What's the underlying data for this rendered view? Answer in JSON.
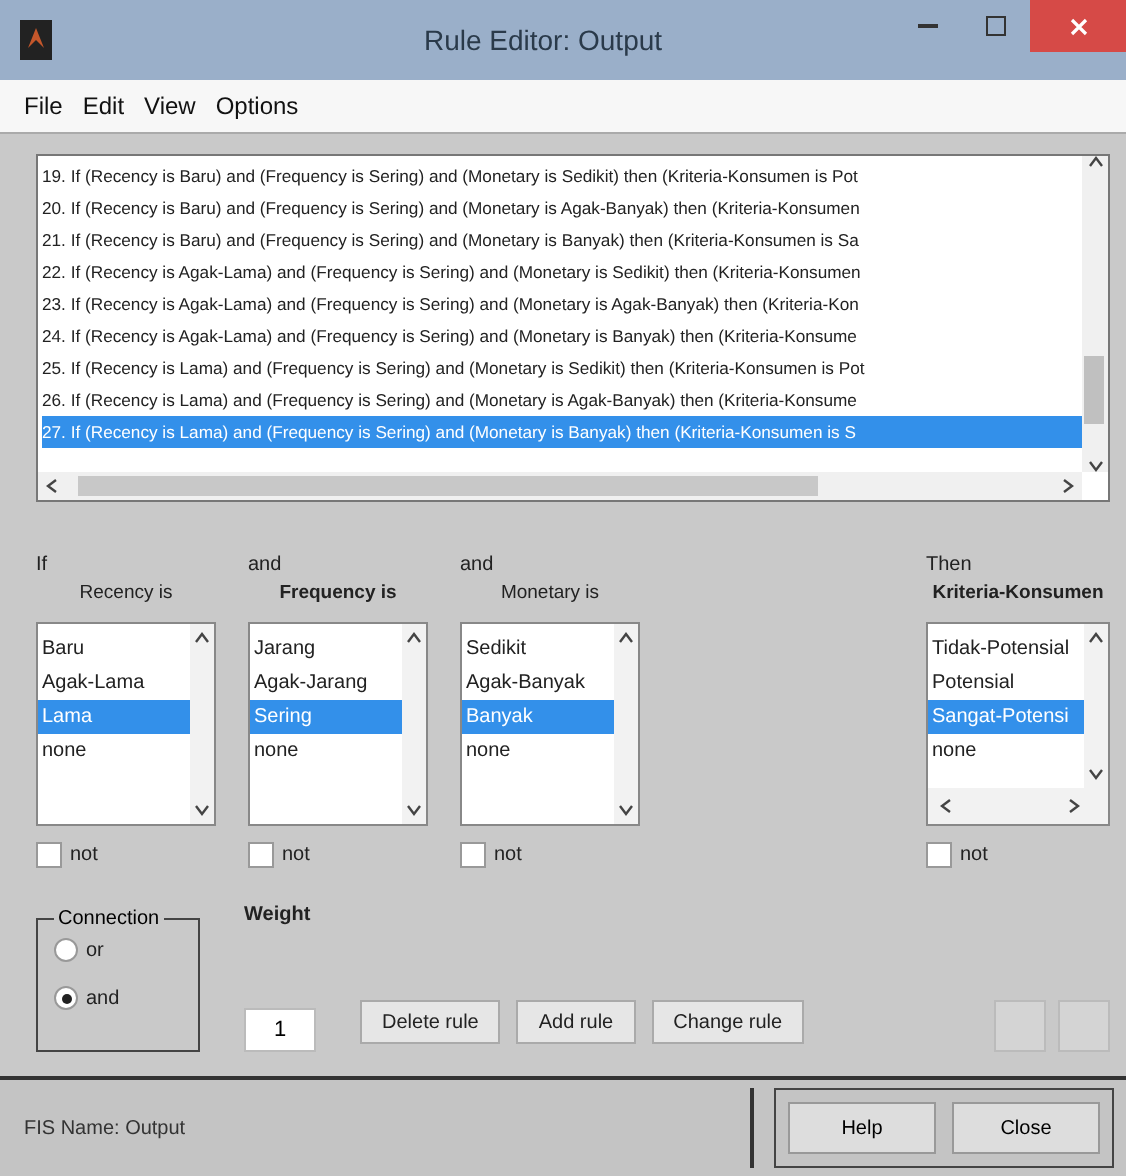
{
  "window": {
    "title": "Rule Editor: Output"
  },
  "menu": [
    "File",
    "Edit",
    "View",
    "Options"
  ],
  "rules": [
    {
      "text": "19. If (Recency is Baru) and (Frequency is Sering) and (Monetary is Sedikit) then (Kriteria-Konsumen is Pot",
      "selected": false
    },
    {
      "text": "20. If (Recency is Baru) and (Frequency is Sering) and (Monetary is Agak-Banyak) then (Kriteria-Konsumen",
      "selected": false
    },
    {
      "text": "21. If (Recency is Baru) and (Frequency is Sering) and (Monetary is Banyak) then (Kriteria-Konsumen is Sa",
      "selected": false
    },
    {
      "text": "22. If (Recency is Agak-Lama) and (Frequency is Sering) and (Monetary is Sedikit) then (Kriteria-Konsumen",
      "selected": false
    },
    {
      "text": "23. If (Recency is Agak-Lama) and (Frequency is Sering) and (Monetary is Agak-Banyak) then (Kriteria-Kon",
      "selected": false
    },
    {
      "text": "24. If (Recency is Agak-Lama) and (Frequency is Sering) and (Monetary is Banyak) then (Kriteria-Konsume",
      "selected": false
    },
    {
      "text": "25. If (Recency is Lama) and (Frequency is Sering) and (Monetary is Sedikit) then (Kriteria-Konsumen is Pot",
      "selected": false
    },
    {
      "text": "26. If (Recency is Lama) and (Frequency is Sering) and (Monetary is Agak-Banyak) then (Kriteria-Konsume",
      "selected": false
    },
    {
      "text": "27. If (Recency is Lama) and (Frequency is Sering) and (Monetary is Banyak) then (Kriteria-Konsumen is S",
      "selected": true
    }
  ],
  "variables": [
    {
      "kind": "input",
      "connector": "If",
      "label": "Recency is",
      "items": [
        {
          "label": "Baru",
          "selected": false
        },
        {
          "label": "Agak-Lama",
          "selected": false
        },
        {
          "label": "Lama",
          "selected": true
        },
        {
          "label": "none",
          "selected": false
        }
      ],
      "negate": {
        "label": "not",
        "checked": false
      }
    },
    {
      "kind": "input",
      "connector": "and",
      "label": "Frequency is",
      "items": [
        {
          "label": "Jarang",
          "selected": false
        },
        {
          "label": "Agak-Jarang",
          "selected": false
        },
        {
          "label": "Sering",
          "selected": true
        },
        {
          "label": "none",
          "selected": false
        }
      ],
      "negate": {
        "label": "not",
        "checked": false
      }
    },
    {
      "kind": "input",
      "connector": "and",
      "label": "Monetary is",
      "items": [
        {
          "label": "Sedikit",
          "selected": false
        },
        {
          "label": "Agak-Banyak",
          "selected": false
        },
        {
          "label": "Banyak",
          "selected": true
        },
        {
          "label": "none",
          "selected": false
        }
      ],
      "negate": {
        "label": "not",
        "checked": false
      }
    },
    {
      "kind": "output",
      "connector": "Then",
      "label": "Kriteria-Konsumen",
      "items": [
        {
          "label": "Tidak-Potensial",
          "selected": false
        },
        {
          "label": "Potensial",
          "selected": false
        },
        {
          "label": "Sangat-Potensi",
          "selected": true
        },
        {
          "label": "none",
          "selected": false
        }
      ],
      "negate": {
        "label": "not",
        "checked": false
      }
    }
  ],
  "connection": {
    "title": "Connection",
    "options": [
      {
        "label": "or",
        "selected": false
      },
      {
        "label": "and",
        "selected": true
      }
    ]
  },
  "weight": {
    "label": "Weight",
    "value": "1"
  },
  "actions": [
    {
      "label": "Delete rule"
    },
    {
      "label": "Add rule"
    },
    {
      "label": "Change rule"
    }
  ],
  "nav_buttons": [
    {
      "disabled": true
    },
    {
      "disabled": true
    }
  ],
  "status": "FIS Name: Output",
  "footer_buttons": [
    {
      "label": "Help"
    },
    {
      "label": "Close"
    }
  ]
}
